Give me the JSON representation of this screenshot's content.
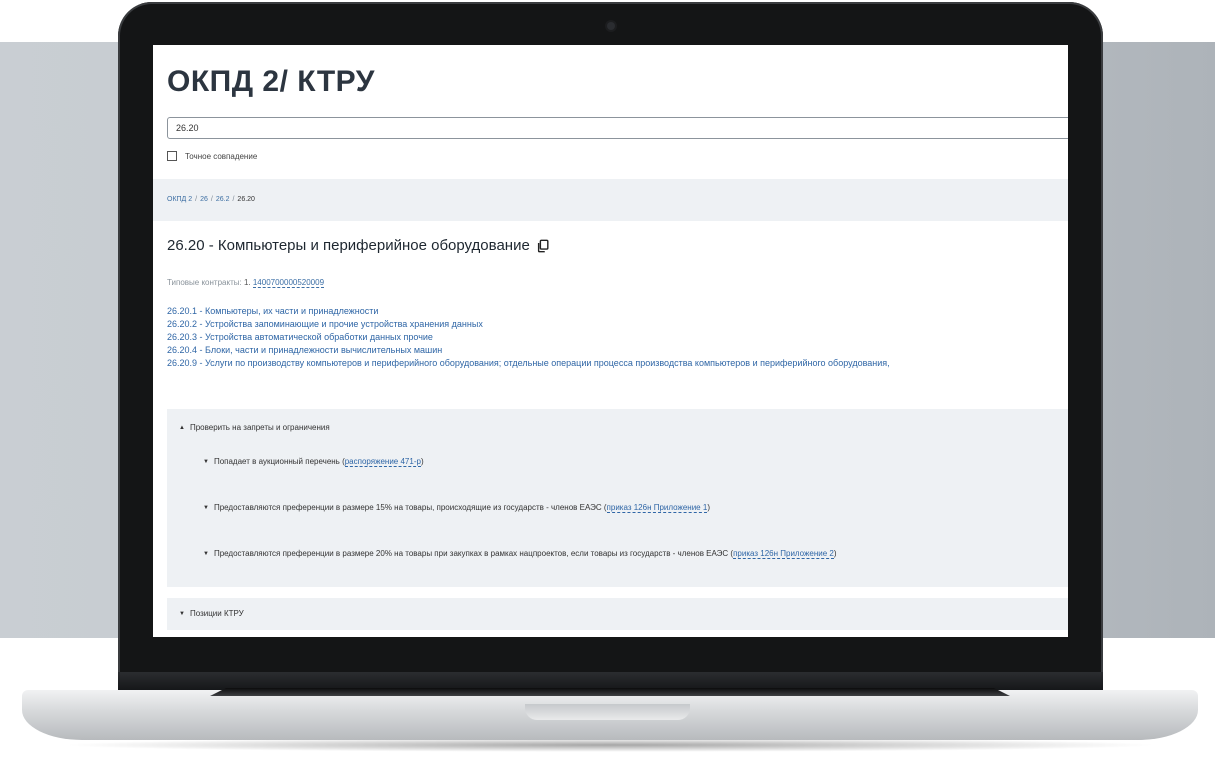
{
  "page": {
    "title": "ОКПД 2/ КТРУ"
  },
  "search": {
    "value": "26.20",
    "exact_match_label": "Точное совпадение"
  },
  "breadcrumb": {
    "items": [
      "ОКПД 2",
      "26",
      "26.2"
    ],
    "separator": "/",
    "current": "26.20"
  },
  "code": {
    "title": "26.20 - Компьютеры и периферийное оборудование",
    "contracts_label": "Типовые контракты:",
    "contracts_index": "1.",
    "contracts_link": "1400700000520009"
  },
  "subcodes": [
    "26.20.1 - Компьютеры, их части и принадлежности",
    "26.20.2 - Устройства запоминающие и прочие устройства хранения данных",
    "26.20.3 - Устройства автоматической обработки данных прочие",
    "26.20.4 - Блоки, части и принадлежности вычислительных машин",
    "26.20.9 - Услуги по производству компьютеров и периферийного оборудования; отдельные операции процесса производства компьютеров и периферийного оборудования,"
  ],
  "restrictions": {
    "header": "Проверить на запреты и ограничения",
    "items": [
      {
        "text": "Попадает в аукционный перечень (",
        "link": "распоряжение 471-р",
        "tail": ")"
      },
      {
        "text": "Предоставляются преференции в размере 15% на товары, происходящие из государств - членов ЕАЭС (",
        "link": "приказ 126н Приложение 1",
        "tail": ")"
      },
      {
        "text": "Предоставляются преференции в размере 20% на товары при закупках в рамках нацпроектов, если товары из государств - членов ЕАЭС (",
        "link": "приказ 126н Приложение 2",
        "tail": ")"
      }
    ]
  },
  "ktru": {
    "header": "Позиции КТРУ"
  },
  "icons": {
    "copy": "copy-icon",
    "caret_up": "▲",
    "caret_down": "▼"
  },
  "colors": {
    "link": "#2f66a6",
    "panel_bg": "#eef1f4",
    "title": "#2c3540"
  }
}
